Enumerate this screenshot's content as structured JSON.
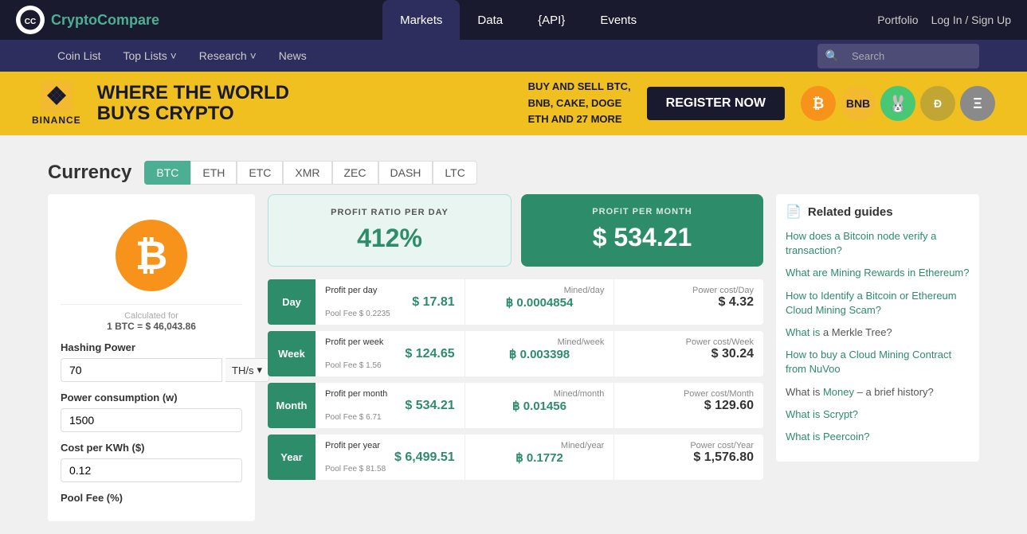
{
  "logo": {
    "icon_text": "CC",
    "text_part1": "Crypto",
    "text_part2": "Compare"
  },
  "top_nav": {
    "tabs": [
      {
        "label": "Markets",
        "active": true
      },
      {
        "label": "Data",
        "active": false
      },
      {
        "label": "{API}",
        "active": false
      },
      {
        "label": "Events",
        "active": false
      }
    ],
    "right_links": [
      "Portfolio",
      "Log In / Sign Up"
    ]
  },
  "sec_nav": {
    "items": [
      {
        "label": "Coin List"
      },
      {
        "label": "Top Lists ˅"
      },
      {
        "label": "Research ˅"
      },
      {
        "label": "News"
      }
    ],
    "search_placeholder": "Search"
  },
  "banner": {
    "brand": "BINANCE",
    "headline_line1": "WHERE THE WORLD",
    "headline_line2": "BUYS CRYPTO",
    "sub_text": "BUY AND SELL BTC,\nBNB, CAKE, DOGE\nETH AND 27 MORE",
    "button_label": "REGISTER NOW"
  },
  "currency": {
    "title": "Currency",
    "tabs": [
      "BTC",
      "ETH",
      "ETC",
      "XMR",
      "ZEC",
      "DASH",
      "LTC"
    ],
    "active_tab": "BTC"
  },
  "calculator": {
    "btc_symbol": "₿",
    "calculated_for": "Calculated for",
    "price_line": "1 BTC = $ 46,043.86",
    "hashing_power_label": "Hashing Power",
    "hashing_power_value": "70",
    "hashing_power_unit": "TH/s",
    "power_consumption_label": "Power consumption (w)",
    "power_consumption_value": "1500",
    "cost_per_kwh_label": "Cost per KWh ($)",
    "cost_per_kwh_value": "0.12",
    "pool_fee_label": "Pool Fee (%)"
  },
  "profit_summary": {
    "ratio_label": "PROFIT RATIO PER DAY",
    "ratio_value": "412%",
    "month_label": "PROFIT PER MONTH",
    "month_value": "$ 534.21"
  },
  "profit_rows": [
    {
      "period": "Day",
      "profit_title": "Profit per day",
      "profit_value": "$ 17.81",
      "pool_fee": "Pool Fee $ 0.2235",
      "mined_title": "Mined/day",
      "mined_value": "฿ 0.0004854",
      "power_title": "Power cost/Day",
      "power_value": "$ 4.32"
    },
    {
      "period": "Week",
      "profit_title": "Profit per week",
      "profit_value": "$ 124.65",
      "pool_fee": "Pool Fee $ 1.56",
      "mined_title": "Mined/week",
      "mined_value": "฿ 0.003398",
      "power_title": "Power cost/Week",
      "power_value": "$ 30.24"
    },
    {
      "period": "Month",
      "profit_title": "Profit per month",
      "profit_value": "$ 534.21",
      "pool_fee": "Pool Fee $ 6.71",
      "mined_title": "Mined/month",
      "mined_value": "฿ 0.01456",
      "power_title": "Power cost/Month",
      "power_value": "$ 129.60"
    },
    {
      "period": "Year",
      "profit_title": "Profit per year",
      "profit_value": "$ 6,499.51",
      "pool_fee": "Pool Fee $ 81.58",
      "mined_title": "Mined/year",
      "mined_value": "฿ 0.1772",
      "power_title": "Power cost/Year",
      "power_value": "$ 1,576.80"
    }
  ],
  "related_guides": {
    "header": "Related guides",
    "guides": [
      {
        "text": "How does a Bitcoin node verify a transaction?",
        "is_link": true
      },
      {
        "text": "What are Mining Rewards in Ethereum?",
        "is_link": true
      },
      {
        "text": "How to Identify a Bitcoin or Ethereum Cloud Mining Scam?",
        "is_link": true
      },
      {
        "text": "What is a Merkle Tree?",
        "is_link": false,
        "link_part": "What is",
        "rest": " a Merkle Tree?"
      },
      {
        "text": "How to buy a Cloud Mining Contract from NuVoo",
        "is_link": true
      },
      {
        "text1": "What is ",
        "link": "Money",
        "text2": " – a brief history?"
      },
      {
        "text_plain": "What is Scrypt?",
        "is_link": true
      },
      {
        "text_plain": "What is Peercoin?",
        "is_link": true
      }
    ]
  },
  "colors": {
    "green": "#2d8c6a",
    "light_green_bg": "#e8f5f0",
    "btc_orange": "#f7931a",
    "banner_yellow": "#f0c020",
    "nav_dark": "#1a1a2e"
  }
}
